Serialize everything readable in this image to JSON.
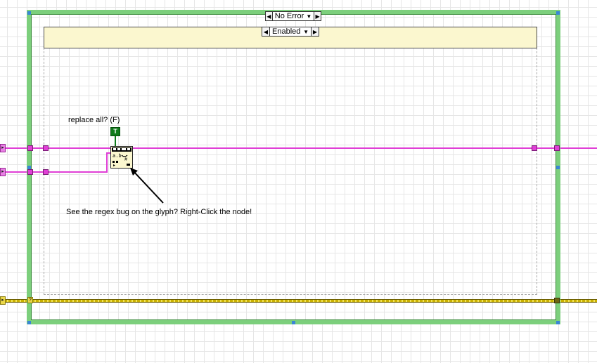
{
  "case_structure": {
    "selector_label": "No Error"
  },
  "diagram_disable": {
    "selector_label": "Enabled"
  },
  "boolean_constant": {
    "label": "replace all? (F)",
    "value_text": "T"
  },
  "annotation": {
    "text": "See the regex bug on the glyph?  Right-Click the node!"
  },
  "error_tunnel": {
    "glyph": "?"
  },
  "colors": {
    "string_wire": "#e03fd6",
    "error_wire": "#c9b000",
    "case_border": "#7ccf7c",
    "disable_header": "#fbf7cf"
  },
  "icons": {
    "node": "search-and-replace-string-icon",
    "arrow": "annotation-arrow-icon"
  }
}
